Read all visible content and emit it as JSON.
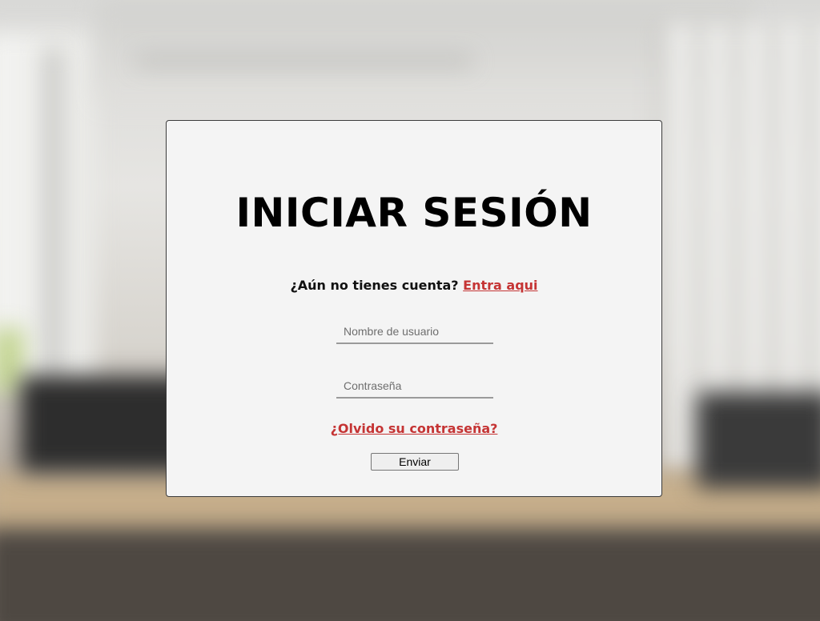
{
  "login": {
    "title": "INICIAR SESIÓN",
    "register_prompt": "¿Aún no tienes cuenta?",
    "register_link": "Entra aqui",
    "username_placeholder": "Nombre de usuario",
    "username_value": "",
    "password_placeholder": "Contraseña",
    "password_value": "",
    "forgot_link": "¿Olvido su contraseña?",
    "submit_label": "Enviar"
  },
  "colors": {
    "card_background": "#f4f4f4",
    "link": "#c53434",
    "title": "#000000"
  }
}
